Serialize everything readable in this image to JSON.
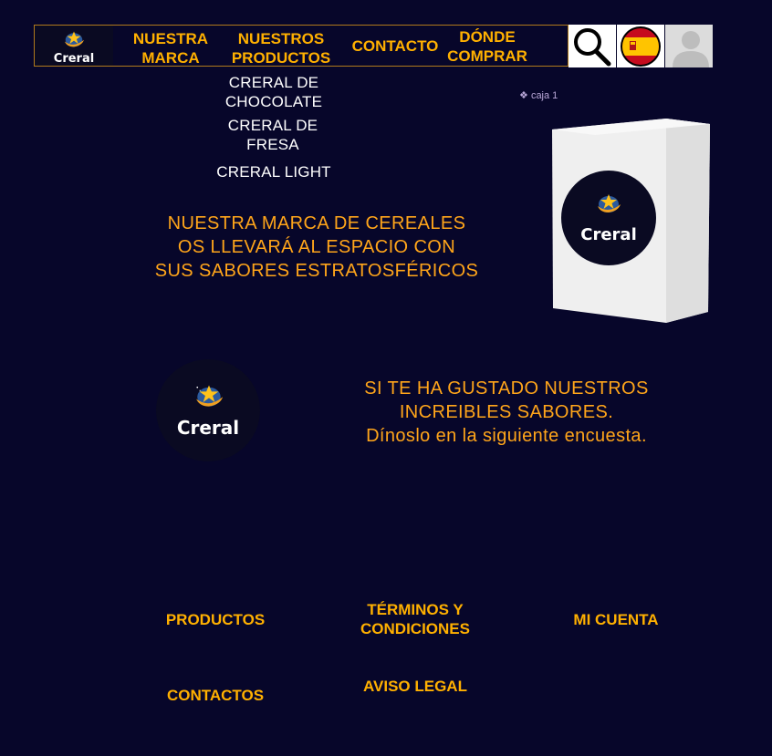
{
  "brand": {
    "logo_text": "Creral"
  },
  "nav": {
    "items": [
      {
        "label_line1": "NUESTRA",
        "label_line2": "MARCA"
      },
      {
        "label_line1": "NUESTROS",
        "label_line2": "PRODUCTOS"
      },
      {
        "label": "CONTACTO"
      },
      {
        "label_line1": "DÓNDE",
        "label_line2": "COMPRAR"
      }
    ]
  },
  "header_icons": {
    "search": "search-icon",
    "language": "spain-flag-icon",
    "account": "user-avatar-icon"
  },
  "products_submenu": [
    {
      "line1": "CRERAL DE",
      "line2": "CHOCOLATE"
    },
    {
      "line1": "CRERAL DE",
      "line2": "FRESA"
    },
    {
      "line1": "CRERAL LIGHT"
    }
  ],
  "hero": {
    "line1": "NUESTRA MARCA DE CEREALES",
    "line2": "OS LLEVARÁ AL ESPACIO CON",
    "line3": "SUS SABORES ESTRATOSFÉRICOS"
  },
  "product_image": {
    "caption": "caja 1"
  },
  "survey": {
    "line1": "SI TE HA GUSTADO NUESTROS",
    "line2": "INCREIBLES SABORES.",
    "line3": "Dínoslo en la siguiente encuesta."
  },
  "footer": {
    "productos": "PRODUCTOS",
    "terminos_line1": "TÉRMINOS Y",
    "terminos_line2": "CONDICIONES",
    "mi_cuenta": "MI CUENTA",
    "contactos": "CONTACTOS",
    "aviso_legal": "AVISO LEGAL"
  },
  "colors": {
    "background": "#07062a",
    "accent": "#ffb000",
    "text_white": "#ffffff"
  }
}
